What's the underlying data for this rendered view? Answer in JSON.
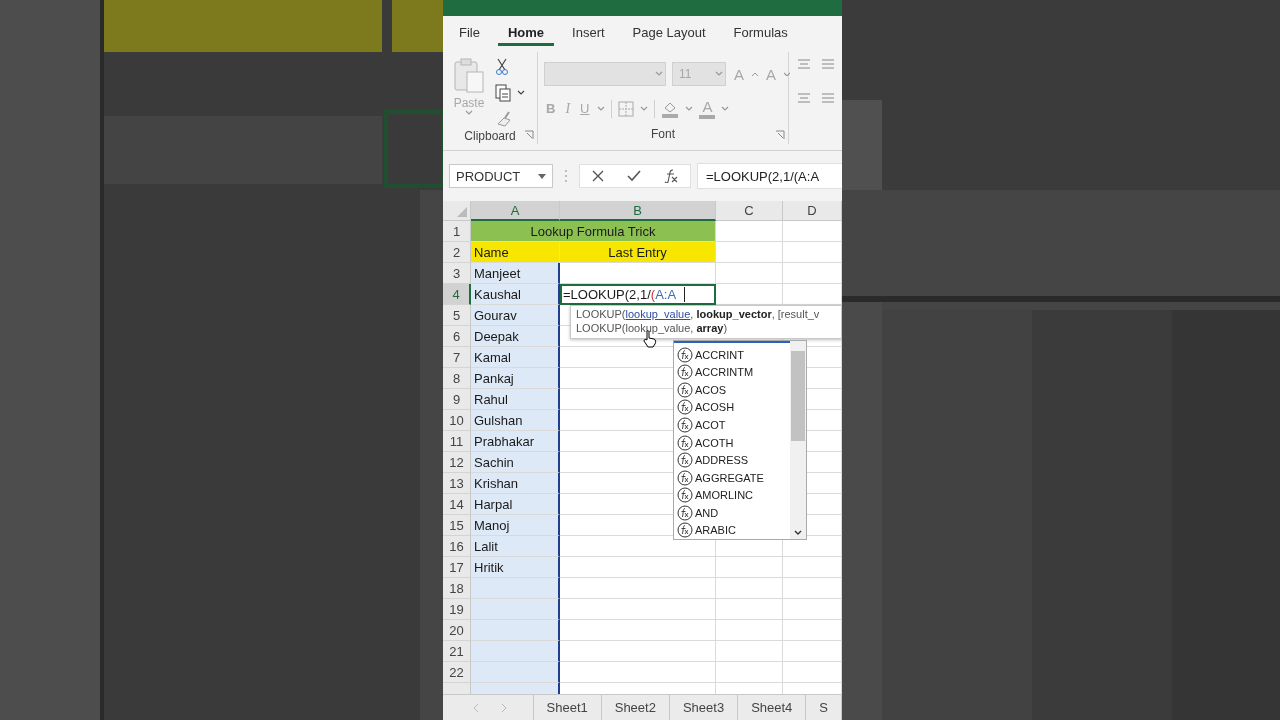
{
  "ribbon_tabs": [
    {
      "label": "File",
      "selected": false
    },
    {
      "label": "Home",
      "selected": true
    },
    {
      "label": "Insert",
      "selected": false
    },
    {
      "label": "Page Layout",
      "selected": false
    },
    {
      "label": "Formulas",
      "selected": false
    }
  ],
  "clipboard": {
    "paste": "Paste",
    "label": "Clipboard",
    "disabled": true
  },
  "font": {
    "label": "Font",
    "size": "11",
    "grow": "A",
    "shrink": "A",
    "bold": "B",
    "italic": "I",
    "underline": "U",
    "font_color_glyph": "A",
    "disabled": true
  },
  "formula_bar": {
    "name_box": "PRODUCT",
    "formula": "=LOOKUP(2,1/(A:A"
  },
  "columns": [
    {
      "label": "A",
      "selected": true,
      "referenced": true
    },
    {
      "label": "B",
      "selected": true,
      "referenced": false
    },
    {
      "label": "C",
      "selected": false,
      "referenced": false
    },
    {
      "label": "D",
      "selected": false,
      "referenced": false
    }
  ],
  "rows": [
    {
      "number": "1",
      "selected": false,
      "kind": "merged",
      "text": "Lookup Formula Trick"
    },
    {
      "number": "2",
      "selected": false,
      "kind": "header",
      "a": "Name",
      "b": "Last Entry"
    },
    {
      "number": "3",
      "selected": false,
      "kind": "data",
      "a": "Manjeet"
    },
    {
      "number": "4",
      "selected": true,
      "kind": "edit",
      "a": "Kaushal",
      "formula": [
        {
          "text": "=LOOKUP(2,1/",
          "kind": "plain"
        },
        {
          "text": "(",
          "kind": "paren"
        },
        {
          "text": "A:A",
          "kind": "ref"
        }
      ]
    },
    {
      "number": "5",
      "selected": false,
      "kind": "data",
      "a": "Gourav"
    },
    {
      "number": "6",
      "selected": false,
      "kind": "data",
      "a": "Deepak"
    },
    {
      "number": "7",
      "selected": false,
      "kind": "data",
      "a": "Kamal"
    },
    {
      "number": "8",
      "selected": false,
      "kind": "data",
      "a": "Pankaj"
    },
    {
      "number": "9",
      "selected": false,
      "kind": "data",
      "a": "Rahul"
    },
    {
      "number": "10",
      "selected": false,
      "kind": "data",
      "a": "Gulshan"
    },
    {
      "number": "11",
      "selected": false,
      "kind": "data",
      "a": "Prabhakar"
    },
    {
      "number": "12",
      "selected": false,
      "kind": "data",
      "a": "Sachin"
    },
    {
      "number": "13",
      "selected": false,
      "kind": "data",
      "a": "Krishan"
    },
    {
      "number": "14",
      "selected": false,
      "kind": "data",
      "a": "Harpal"
    },
    {
      "number": "15",
      "selected": false,
      "kind": "data",
      "a": "Manoj"
    },
    {
      "number": "16",
      "selected": false,
      "kind": "data",
      "a": "Lalit"
    },
    {
      "number": "17",
      "selected": false,
      "kind": "data",
      "a": "Hritik"
    },
    {
      "number": "18",
      "selected": false,
      "kind": "data"
    },
    {
      "number": "19",
      "selected": false,
      "kind": "data"
    },
    {
      "number": "20",
      "selected": false,
      "kind": "data"
    },
    {
      "number": "21",
      "selected": false,
      "kind": "data"
    },
    {
      "number": "22",
      "selected": false,
      "kind": "data"
    },
    {
      "selected": false,
      "kind": "partial"
    }
  ],
  "tooltip": {
    "function": "LOOKUP(",
    "current_arg": "lookup_value",
    "rest": ", **lookup_vector**, [result_v",
    "second": "LOOKUP(lookup_value, **array**)"
  },
  "autocomplete": {
    "items": [
      "ACCRINT",
      "ACCRINTM",
      "ACOS",
      "ACOSH",
      "ACOT",
      "ACOTH",
      "ADDRESS",
      "AGGREGATE",
      "AMORLINC",
      "AND",
      "ARABIC"
    ]
  },
  "sheet_tabs": [
    {
      "label": "Sheet1",
      "selected": false
    },
    {
      "label": "Sheet2",
      "selected": false
    },
    {
      "label": "Sheet3",
      "selected": false
    },
    {
      "label": "Sheet4",
      "selected": false
    },
    {
      "label": "S",
      "selected": false
    }
  ]
}
